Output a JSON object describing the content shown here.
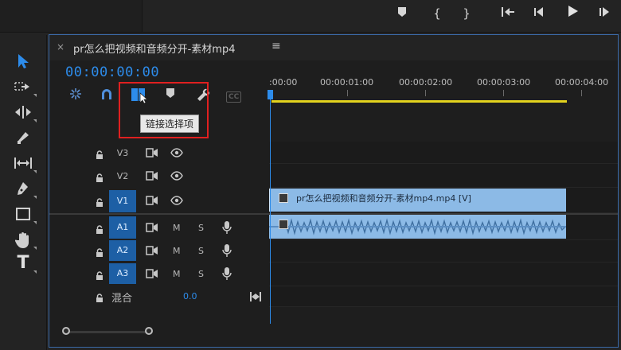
{
  "top_controls": {
    "buttons": [
      {
        "name": "add-marker-icon"
      },
      {
        "name": "mark-in-icon",
        "label": "{"
      },
      {
        "name": "mark-out-icon",
        "label": "}"
      },
      {
        "name": "go-to-in-icon"
      },
      {
        "name": "step-back-icon"
      },
      {
        "name": "play-icon"
      },
      {
        "name": "step-forward-icon"
      }
    ]
  },
  "tools": [
    {
      "name": "selection-tool",
      "icon": "arrow-icon",
      "selected": true
    },
    {
      "name": "track-select-tool",
      "icon": "track-select-icon"
    },
    {
      "name": "ripple-edit-tool",
      "icon": "ripple-edit-icon"
    },
    {
      "name": "razor-tool",
      "icon": "razor-icon"
    },
    {
      "name": "slip-tool",
      "icon": "slip-icon"
    },
    {
      "name": "pen-tool",
      "icon": "pen-icon"
    },
    {
      "name": "rectangle-tool",
      "icon": "rectangle-icon"
    },
    {
      "name": "hand-tool",
      "icon": "hand-icon"
    },
    {
      "name": "type-tool",
      "icon": "type-icon",
      "label": "T"
    }
  ],
  "panel": {
    "close_label": "×",
    "title": "pr怎么把视频和音频分开-素材mp4",
    "menu_label": "≡",
    "timecode": "00:00:00:00"
  },
  "timeline_tools": [
    {
      "name": "snap-icon"
    },
    {
      "name": "linked-selection-icon"
    },
    {
      "name": "link-select-icon",
      "active": true
    },
    {
      "name": "add-marker-icon"
    },
    {
      "name": "settings-wrench-icon"
    },
    {
      "name": "captions-icon",
      "label": "CC"
    }
  ],
  "tooltip": "链接选择项",
  "ruler": {
    "labels": [
      ":00:00",
      "00:00:01:00",
      "00:00:02:00",
      "00:00:03:00",
      "00:00:04:00"
    ]
  },
  "tracks": {
    "video": [
      {
        "label": "V3",
        "targeted": false
      },
      {
        "label": "V2",
        "targeted": false
      },
      {
        "label": "V1",
        "targeted": true
      }
    ],
    "audio": [
      {
        "label": "A1",
        "m": "M",
        "s": "S"
      },
      {
        "label": "A2",
        "m": "M",
        "s": "S"
      },
      {
        "label": "A3",
        "m": "M",
        "s": "S"
      }
    ],
    "mix": {
      "label": "混合",
      "value": "0.0"
    }
  },
  "clips": {
    "video_clip_label": "pr怎么把视频和音频分开-素材mp4.mp4 [V]"
  },
  "colors": {
    "accent_blue": "#2d8ceb",
    "clip_blue": "#8cbae6",
    "work_area_yellow": "#e3d31e",
    "highlight_red": "#e02020"
  }
}
